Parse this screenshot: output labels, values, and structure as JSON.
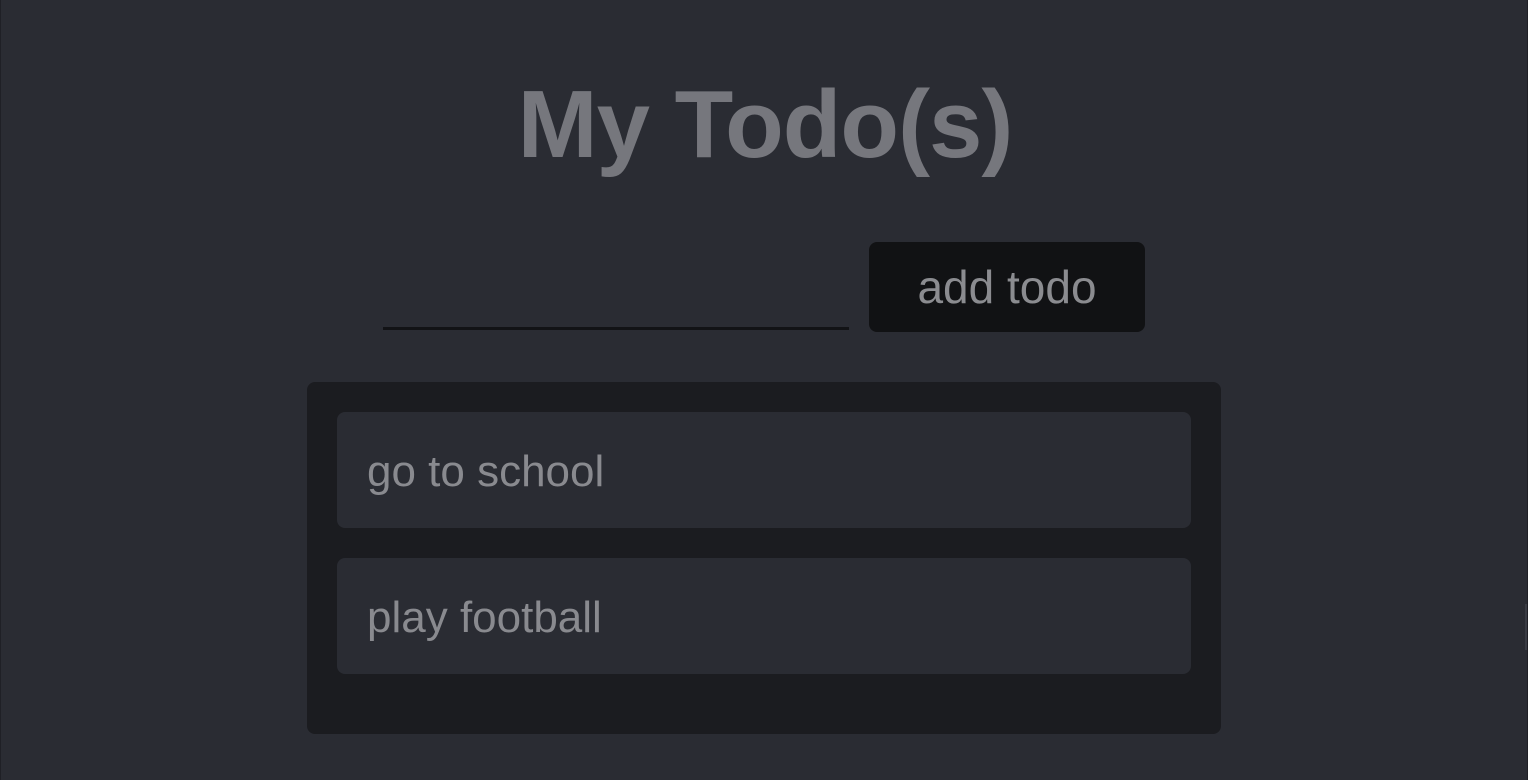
{
  "header": {
    "title": "My Todo(s)"
  },
  "form": {
    "input_value": "",
    "input_placeholder": "",
    "add_label": "add todo"
  },
  "todos": [
    {
      "text": "go to school"
    },
    {
      "text": "play football"
    }
  ],
  "colors": {
    "background": "#2a2c33",
    "panel": "#1b1c20",
    "button": "#111214",
    "text": "#898a8f"
  }
}
